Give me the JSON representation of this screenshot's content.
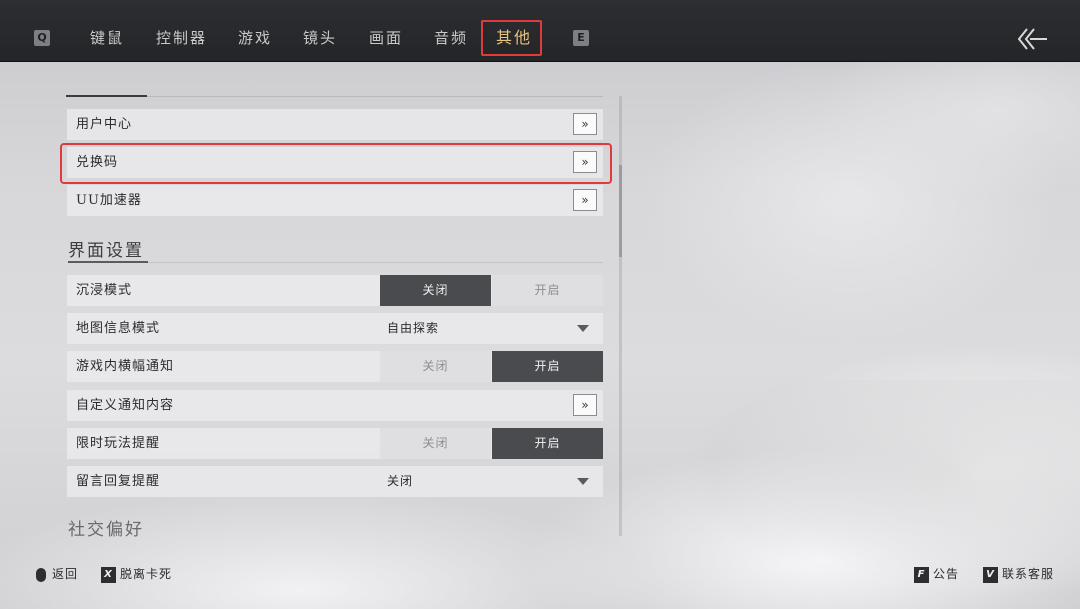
{
  "topbar": {
    "left_key": "Q",
    "right_key": "E",
    "tabs": [
      {
        "label": "键鼠",
        "active": false
      },
      {
        "label": "控制器",
        "active": false
      },
      {
        "label": "游戏",
        "active": false
      },
      {
        "label": "镜头",
        "active": false
      },
      {
        "label": "画面",
        "active": false
      },
      {
        "label": "音频",
        "active": false
      },
      {
        "label": "其他",
        "active": true
      }
    ],
    "active_color": "#e6c27a",
    "back_icon": "double-chevron-left-arrow-icon"
  },
  "account_rows": [
    {
      "label": "用户中心",
      "action": "»"
    },
    {
      "label": "兑换码",
      "action": "»",
      "highlighted": true
    },
    {
      "label": "UU加速器",
      "action": "»"
    }
  ],
  "interface_section": {
    "title": "界面设置",
    "rows": [
      {
        "label": "沉浸模式",
        "type": "toggle",
        "off_label": "关闭",
        "on_label": "开启",
        "value": "off"
      },
      {
        "label": "地图信息模式",
        "type": "dropdown",
        "value": "自由探索"
      },
      {
        "label": "游戏内横幅通知",
        "type": "toggle",
        "off_label": "关闭",
        "on_label": "开启",
        "value": "on"
      },
      {
        "label": "自定义通知内容",
        "type": "link",
        "action": "»"
      },
      {
        "label": "限时玩法提醒",
        "type": "toggle",
        "off_label": "关闭",
        "on_label": "开启",
        "value": "on"
      },
      {
        "label": "留言回复提醒",
        "type": "dropdown",
        "value": "关闭"
      }
    ]
  },
  "social_section": {
    "title": "社交偏好"
  },
  "bottom_hints": {
    "back": {
      "icon": "mouse-icon",
      "label": "返回"
    },
    "unstuck": {
      "key": "X",
      "label": "脱离卡死"
    },
    "notice": {
      "key": "F",
      "label": "公告"
    },
    "support": {
      "key": "V",
      "label": "联系客服"
    }
  },
  "highlight_color": "#e03b3b"
}
